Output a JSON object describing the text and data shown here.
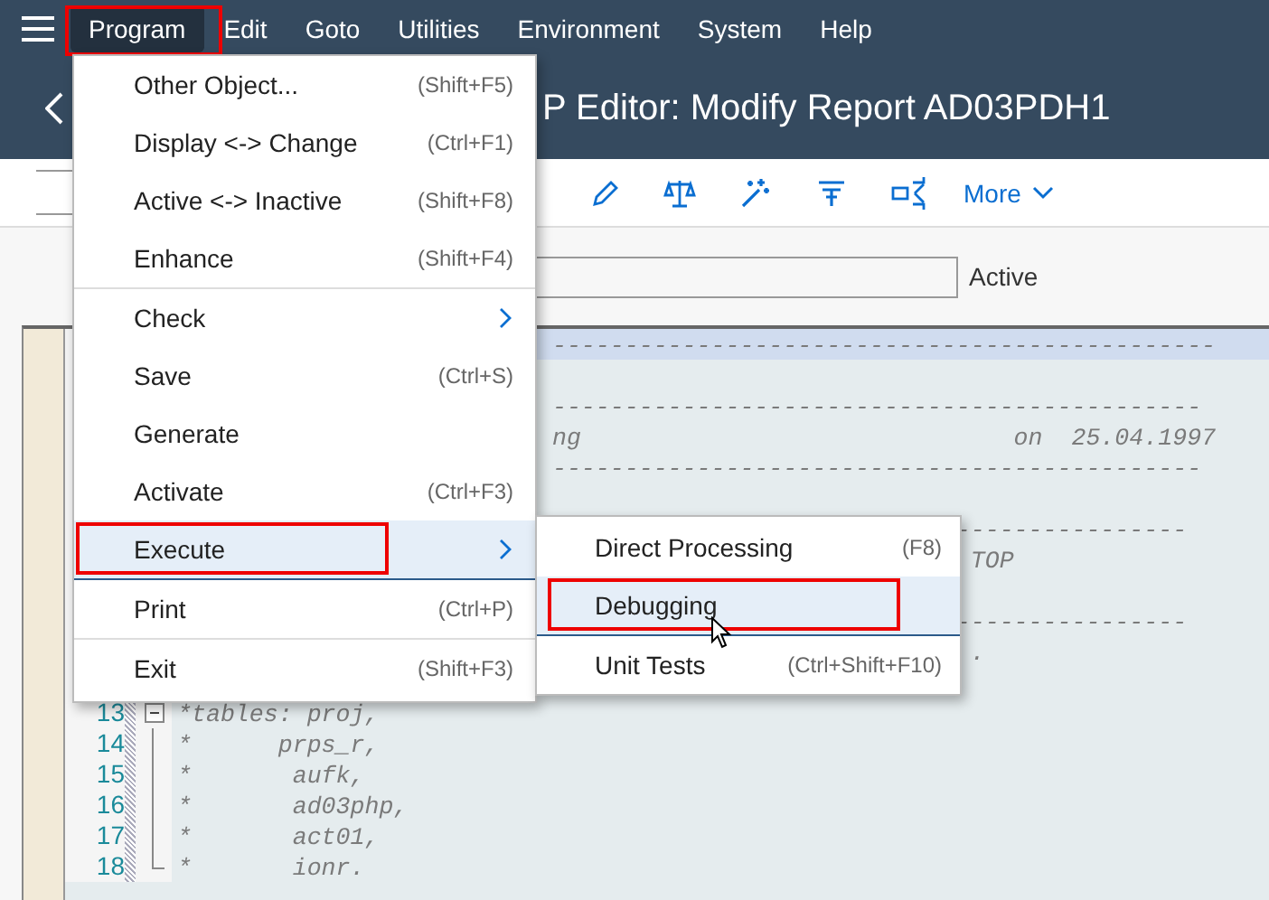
{
  "menu_bar": [
    {
      "label": "Program",
      "selected": true,
      "highlighted": true
    },
    {
      "label": "Edit",
      "selected": false,
      "highlighted": false
    },
    {
      "label": "Goto",
      "selected": false,
      "highlighted": false
    },
    {
      "label": "Utilities",
      "selected": false,
      "highlighted": false
    },
    {
      "label": "Environment",
      "selected": false,
      "highlighted": false
    },
    {
      "label": "System",
      "selected": false,
      "highlighted": false
    },
    {
      "label": "Help",
      "selected": false,
      "highlighted": false
    }
  ],
  "title": "P Editor: Modify Report AD03PDH1",
  "toolbar": {
    "more": "More"
  },
  "status_field": {
    "text": "Active"
  },
  "editor": {
    "lines": [
      {
        "text": "                          ----------------------------------------------",
        "current": true
      },
      {
        "blank": true
      },
      {
        "text": "                          ---------------------------------------------"
      },
      {
        "text": "                          ng                              on  25.04.1997"
      },
      {
        "text": "                          ---------------------------------------------"
      },
      {
        "blank": true
      },
      {
        "text": "                                                      ----------------"
      },
      {
        "text": "                                                       TOP"
      },
      {
        "blank": true
      },
      {
        "text": "                                                      ----------------"
      },
      {
        "text": "                                                       ."
      },
      {
        "blank": true
      },
      {
        "number": "13",
        "text": "*tables: proj,",
        "fold_start": true
      },
      {
        "number": "14",
        "text": "*      prps_r,",
        "fold_line": true
      },
      {
        "number": "15",
        "text": "*       aufk,",
        "fold_line": true
      },
      {
        "number": "16",
        "text": "*       ad03php,",
        "fold_line": true
      },
      {
        "number": "17",
        "text": "*       act01,",
        "fold_line": true
      },
      {
        "number": "18",
        "text": "*       ionr.",
        "fold_end": true
      }
    ]
  },
  "menu": {
    "items": [
      {
        "label": "Other Object...",
        "shortcut": "(Shift+F5)",
        "selected": false,
        "highlighted": false,
        "separator": false
      },
      {
        "label": "Display <-> Change",
        "shortcut": "(Ctrl+F1)",
        "selected": false,
        "highlighted": false,
        "separator": false
      },
      {
        "label": "Active <-> Inactive",
        "shortcut": "(Shift+F8)",
        "selected": false,
        "highlighted": false,
        "separator": false
      },
      {
        "label": "Enhance",
        "shortcut": "(Shift+F4)",
        "selected": false,
        "highlighted": false,
        "separator": true
      },
      {
        "label": "Check",
        "submenu": true,
        "selected": false,
        "highlighted": false,
        "separator": false
      },
      {
        "label": "Save",
        "shortcut": "(Ctrl+S)",
        "selected": false,
        "highlighted": false,
        "separator": false
      },
      {
        "label": "Generate",
        "selected": false,
        "highlighted": false,
        "separator": false
      },
      {
        "label": "Activate",
        "shortcut": "(Ctrl+F3)",
        "selected": false,
        "highlighted": false,
        "separator": false
      },
      {
        "label": "Execute",
        "submenu": true,
        "selected": true,
        "highlighted": true,
        "separator": false
      },
      {
        "label": "Print",
        "shortcut": "(Ctrl+P)",
        "selected": false,
        "highlighted": false,
        "separator": true
      },
      {
        "label": "Exit",
        "shortcut": "(Shift+F3)",
        "selected": false,
        "highlighted": false,
        "separator": false
      }
    ]
  },
  "submenu": {
    "items": [
      {
        "label": "Direct Processing",
        "shortcut": "(F8)",
        "selected": false,
        "highlighted": false
      },
      {
        "label": "Debugging",
        "selected": true,
        "highlighted": true
      },
      {
        "label": "Unit Tests",
        "shortcut": "(Ctrl+Shift+F10)",
        "selected": false,
        "highlighted": false
      }
    ]
  }
}
